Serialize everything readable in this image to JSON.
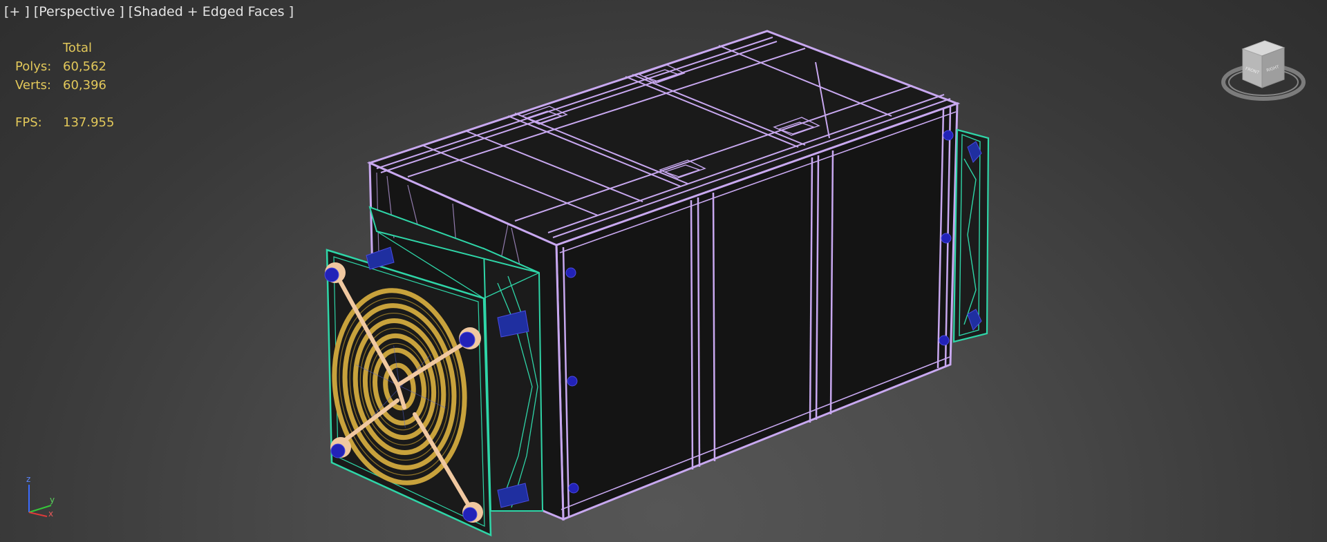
{
  "viewport": {
    "plus_label": "[+ ]",
    "view_label": "[Perspective ]",
    "shading_label": "[Shaded + Edged Faces ]"
  },
  "stats": {
    "header": "Total",
    "polys_label": "Polys:",
    "polys_value": "60,562",
    "verts_label": "Verts:",
    "verts_value": "60,396",
    "fps_label": "FPS:",
    "fps_value": "137.955"
  },
  "axis_tripod": {
    "x_label": "x",
    "y_label": "y",
    "z_label": "z"
  },
  "viewcube": {
    "top_label": "TOP",
    "front_label": "FRONT",
    "right_label": "RIGHT"
  },
  "icons": [
    "viewcube-icon",
    "axis-tripod-icon",
    "fan-grille-icon"
  ],
  "colors": {
    "background": "#3a3a3a",
    "wire_box": "#c8a8f0",
    "wire_fan_housing": "#2fd6a8",
    "fan_grille": "#c8a23c",
    "screws": "#2222b8",
    "stats_text": "#e2c85a",
    "label_text": "#e4e4e4"
  }
}
